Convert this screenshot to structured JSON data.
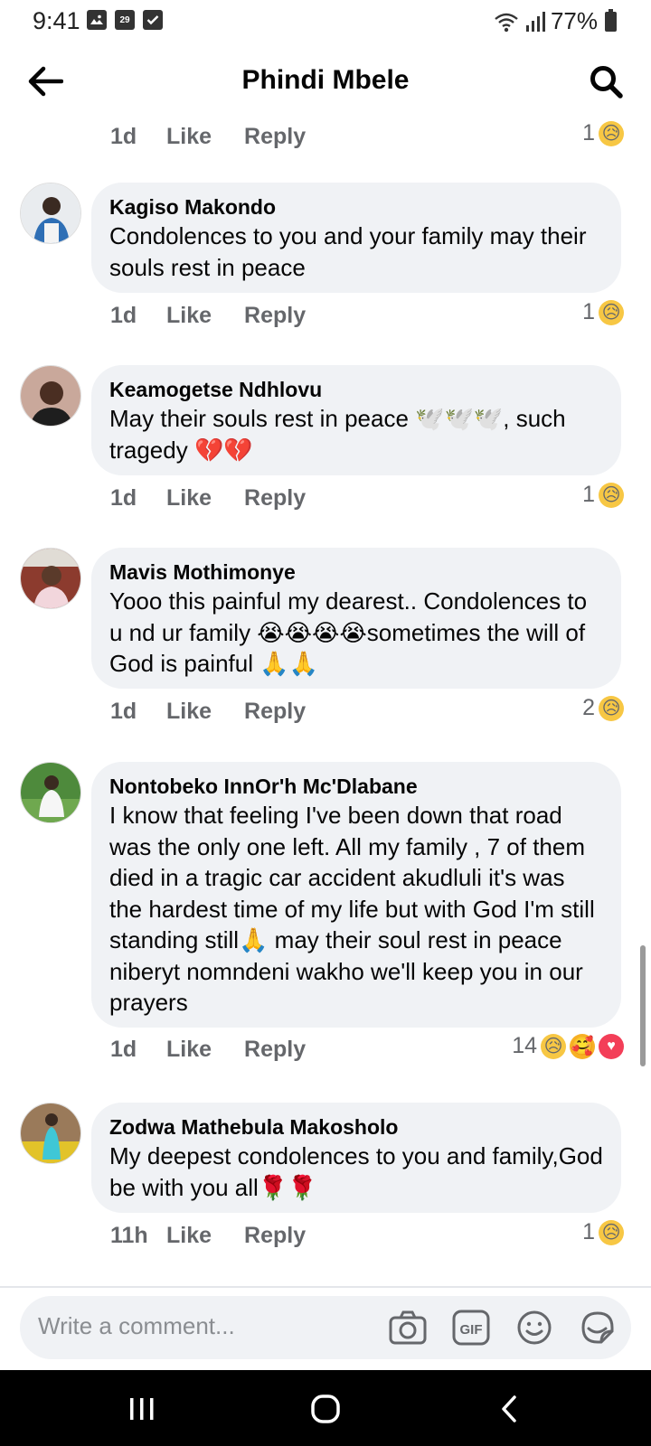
{
  "status_bar": {
    "time": "9:41",
    "calendar_day": "29",
    "battery": "77%"
  },
  "header": {
    "title": "Phindi Mbele"
  },
  "comments": [
    {
      "author": "",
      "text": "",
      "time": "1d",
      "like_label": "Like",
      "reply_label": "Reply",
      "reaction_count": "1",
      "reactions": [
        "sad"
      ]
    },
    {
      "author": "Kagiso Makondo",
      "text": "Condolences to you and your family may their souls rest in peace",
      "time": "1d",
      "like_label": "Like",
      "reply_label": "Reply",
      "reaction_count": "1",
      "reactions": [
        "sad"
      ]
    },
    {
      "author": "Keamogetse Ndhlovu",
      "text": "May their souls rest in peace 🕊️🕊️🕊️, such tragedy 💔💔",
      "time": "1d",
      "like_label": "Like",
      "reply_label": "Reply",
      "reaction_count": "1",
      "reactions": [
        "sad"
      ]
    },
    {
      "author": "Mavis Mothimonye",
      "text": "Yooo this painful my dearest.. Condolences to u nd ur family 😭😭😭😭sometimes the will of God is painful 🙏🙏",
      "time": "1d",
      "like_label": "Like",
      "reply_label": "Reply",
      "reaction_count": "2",
      "reactions": [
        "sad"
      ]
    },
    {
      "author": "Nontobeko InnOr'h Mc'Dlabane",
      "text": "I know that feeling I've been down that road was the only one left. All my family , 7 of them died in a tragic car accident akudluli it's was the hardest time of my life but with God I'm still standing still🙏 may their soul rest in peace niberyt nomndeni wakho we'll keep you in our prayers",
      "time": "1d",
      "like_label": "Like",
      "reply_label": "Reply",
      "reaction_count": "14",
      "reactions": [
        "sad",
        "care",
        "love"
      ]
    },
    {
      "author": "Zodwa Mathebula Makosholo",
      "text": "My deepest condolences to you and family,God be with you all🌹🌹",
      "time": "11h",
      "like_label": "Like",
      "reply_label": "Reply",
      "reaction_count": "1",
      "reactions": [
        "sad"
      ]
    }
  ],
  "composer": {
    "placeholder": "Write a comment..."
  },
  "icons": {
    "back": "arrow-left-icon",
    "search": "search-icon",
    "camera": "camera-icon",
    "gif": "gif-icon",
    "emoji": "emoji-icon",
    "sticker": "sticker-icon",
    "nav_recents": "recents-icon",
    "nav_home": "home-icon",
    "nav_back": "back-icon"
  },
  "colors": {
    "bubble": "#f0f2f5",
    "secondary_text": "#65676b",
    "sad_reaction": "#f7c744",
    "love_reaction": "#f33e58"
  }
}
